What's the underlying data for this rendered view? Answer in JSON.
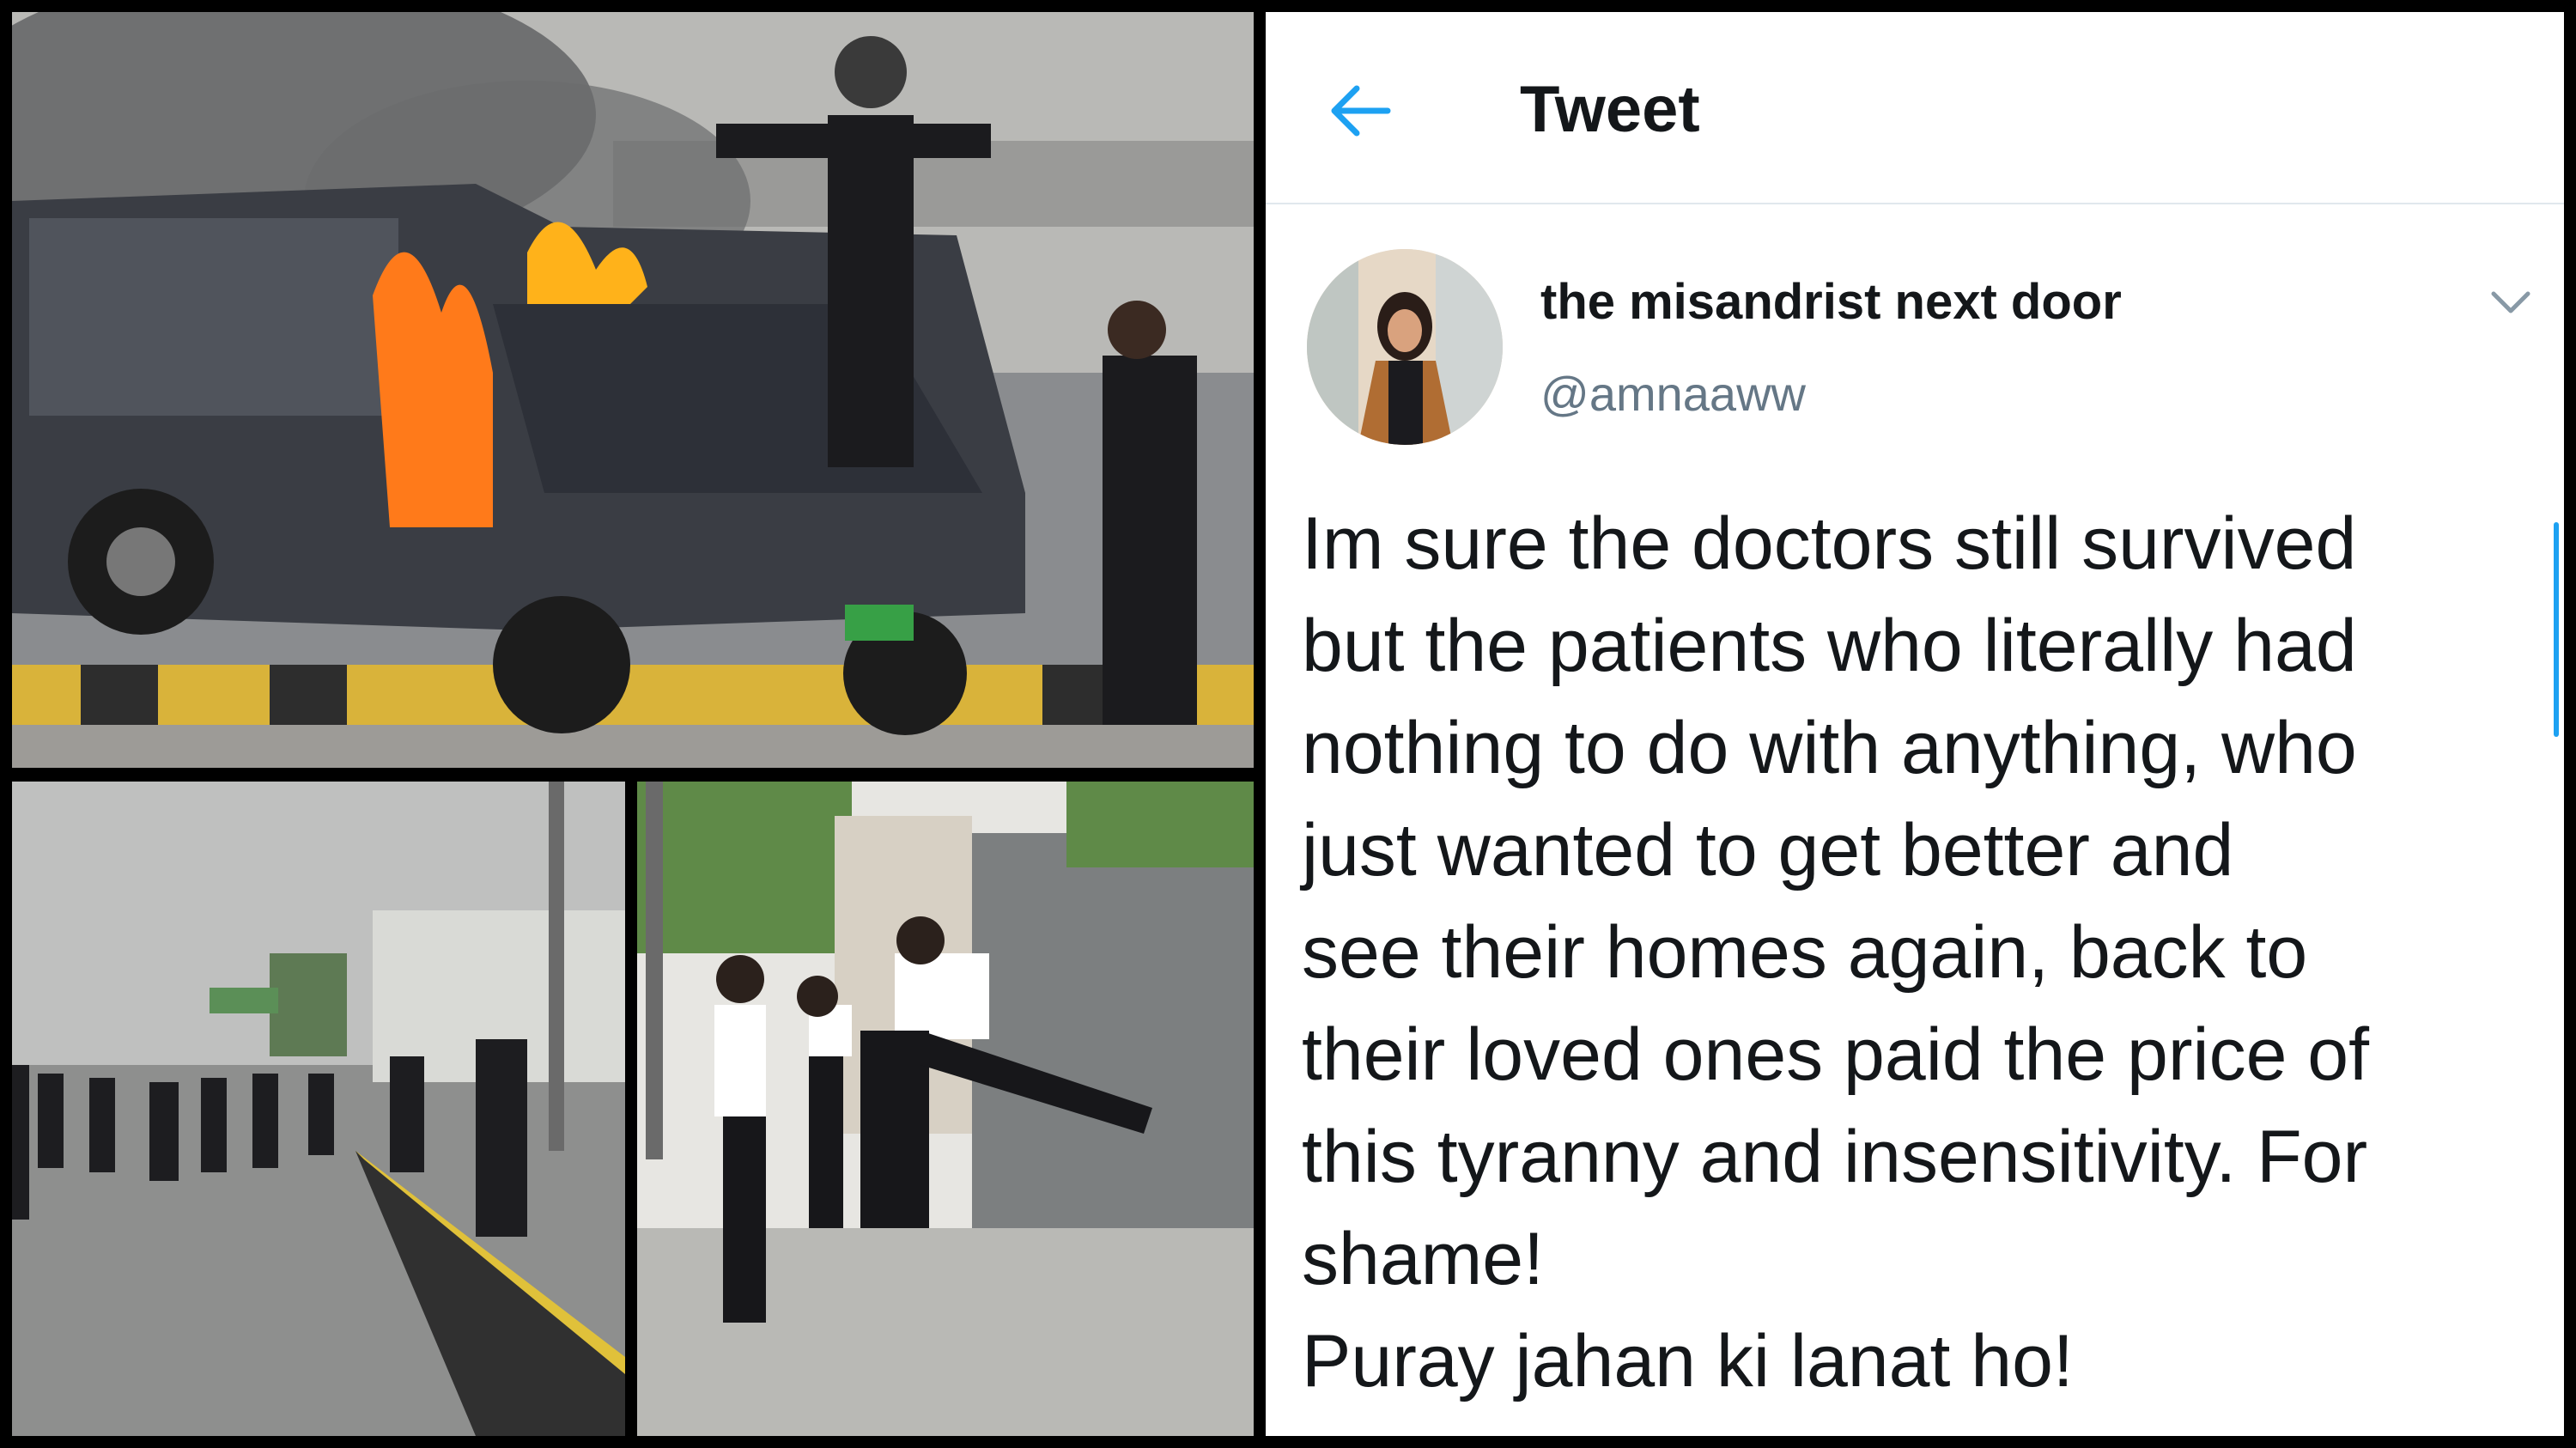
{
  "colors": {
    "accent": "#1da1f2",
    "text_primary": "#14171a",
    "text_secondary": "#657786",
    "fire": "#ff7a1a"
  },
  "tweet": {
    "header_title": "Tweet",
    "back_icon": "arrow-left-icon",
    "author": {
      "display_name": "the misandrist next door",
      "handle": "@amnaaww"
    },
    "menu_icon": "chevron-down-icon",
    "text_lines": [
      "Im sure the doctors still survived",
      "but the patients who literally had",
      "nothing to do with anything, who",
      "just wanted to get better and",
      "see their homes again, back to",
      "their loved ones paid the price of",
      "this tyranny and insensitivity. For",
      "shame!",
      "Puray jahan ki lanat ho!"
    ]
  }
}
